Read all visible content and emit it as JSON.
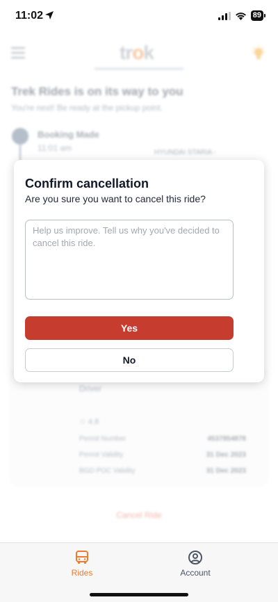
{
  "status_bar": {
    "time": "11:02",
    "battery": "89"
  },
  "app": {
    "logo_prefix": "tr",
    "logo_o": "o",
    "logo_suffix": "k",
    "title": "Trek Rides is on its way to you",
    "subtitle": "You're next! Be ready at the pickup point.",
    "step": {
      "title": "Booking Made",
      "time": "11:01 am"
    },
    "vehicle": "HYUNDAI STARIA -",
    "driver_label": "Driver",
    "rating": "4.8",
    "rows": [
      {
        "label": "Permit Number",
        "value": "4537854878"
      },
      {
        "label": "Permit Validity",
        "value": "31 Dec 2023"
      },
      {
        "label": "BGD POC Validity",
        "value": "31 Dec 2023"
      }
    ],
    "cancel_link": "Cancel Ride"
  },
  "dialog": {
    "title": "Confirm cancellation",
    "subtitle": "Are you sure you want to cancel this ride?",
    "textarea_placeholder": "Help us improve. Tell us why you've decided to cancel this ride.",
    "textarea_value": "",
    "yes_label": "Yes",
    "no_label": "No"
  },
  "tab_bar": {
    "tabs": [
      {
        "label": "Rides",
        "icon": "bus-icon",
        "active": true
      },
      {
        "label": "Account",
        "icon": "account-icon",
        "active": false
      }
    ]
  },
  "colors": {
    "accent": "#f07a2e",
    "danger": "#c63d2f"
  }
}
